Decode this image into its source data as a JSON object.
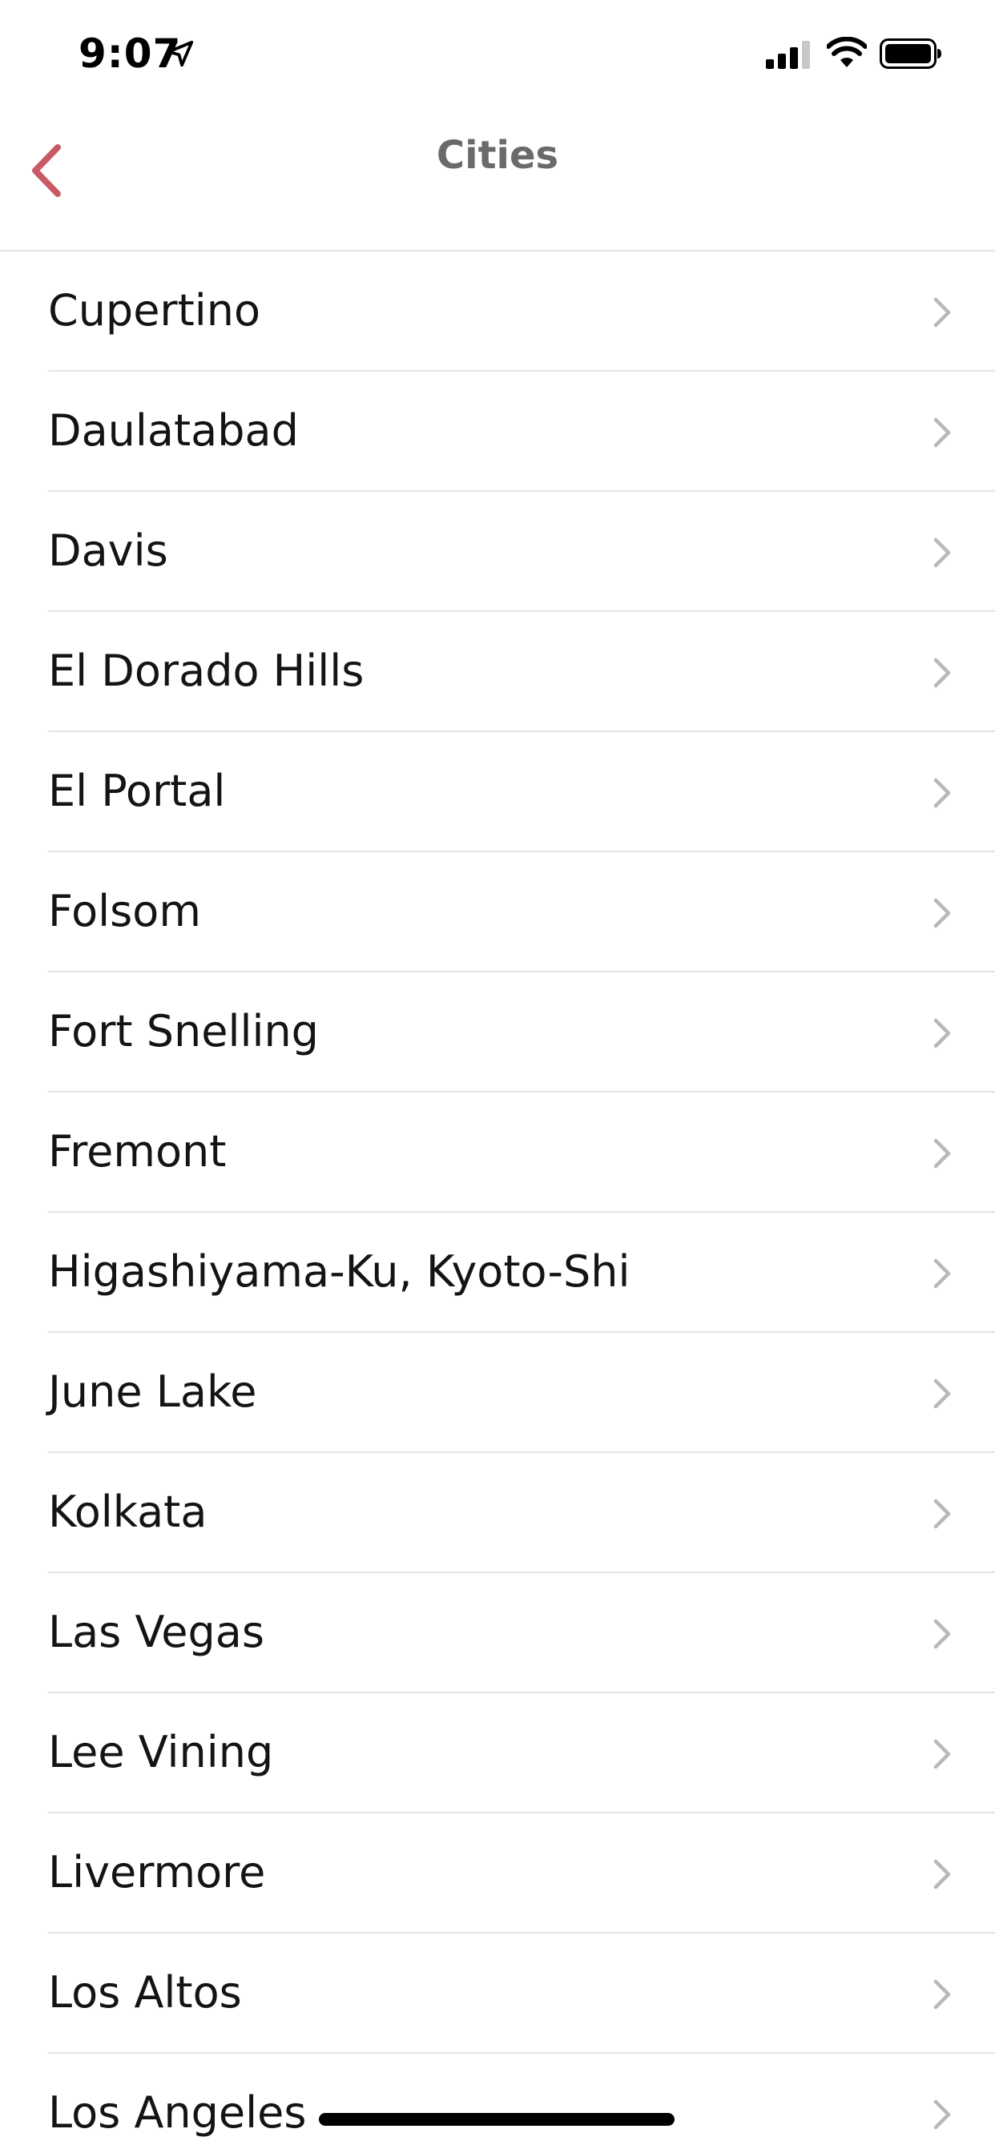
{
  "status_bar": {
    "time": "9:07",
    "icons": [
      "location-arrow-icon",
      "signal-icon",
      "wifi-icon",
      "battery-icon"
    ]
  },
  "nav": {
    "title": "Cities",
    "back_icon": "chevron-left-icon"
  },
  "colors": {
    "accent": "#c85a66",
    "title": "#6a6a6a",
    "text": "#141414",
    "separator": "#e3e3e3",
    "chevron": "#b8b8b8"
  },
  "cities": [
    "Cupertino",
    "Daulatabad",
    "Davis",
    "El Dorado Hills",
    "El Portal",
    "Folsom",
    "Fort Snelling",
    "Fremont",
    "Higashiyama-Ku, Kyoto-Shi",
    "June Lake",
    "Kolkata",
    "Las Vegas",
    "Lee Vining",
    "Livermore",
    "Los Altos",
    "Los Angeles"
  ]
}
